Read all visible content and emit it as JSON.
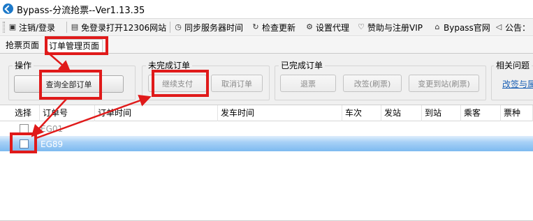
{
  "window": {
    "title": "Bypass-分流抢票--Ver1.13.35"
  },
  "menu": {
    "items": [
      {
        "label": "注销/登录",
        "icon": "logout-icon"
      },
      {
        "label": "免登录打开12306网站",
        "icon": "window-icon"
      },
      {
        "label": "同步服务器时间",
        "icon": "clock-icon"
      },
      {
        "label": "检查更新",
        "icon": "refresh-icon"
      },
      {
        "label": "设置代理",
        "icon": "gear-icon"
      },
      {
        "label": "赞助与注册VIP",
        "icon": "heart-icon"
      },
      {
        "label": "Bypass官网",
        "icon": "home-icon"
      },
      {
        "label": "公告：",
        "icon": "speaker-icon"
      }
    ]
  },
  "tabs": [
    {
      "label": "抢票页面",
      "active": false
    },
    {
      "label": "订单管理页面",
      "active": true
    }
  ],
  "groups": {
    "operate": {
      "label": "操作",
      "query_all": "查询全部订单"
    },
    "unfinished": {
      "label": "未完成订单",
      "continue_pay": "继续支付",
      "cancel": "取消订单"
    },
    "finished": {
      "label": "已完成订单",
      "refund": "退票",
      "change": "改签(刷票)",
      "change_station": "变更到站(刷票)"
    },
    "related": {
      "label": "相关问题",
      "link": "改签与属"
    }
  },
  "table": {
    "columns": [
      "选择",
      "订单号",
      "订单时间",
      "发车时间",
      "车次",
      "发站",
      "到站",
      "乘客",
      "票种"
    ],
    "rows": [
      {
        "selected": false,
        "order_no": "EG01"
      },
      {
        "selected": true,
        "order_no": "EG89"
      }
    ]
  },
  "annotation_color": "#e01a1a",
  "selection_color": "#7dbaf0"
}
